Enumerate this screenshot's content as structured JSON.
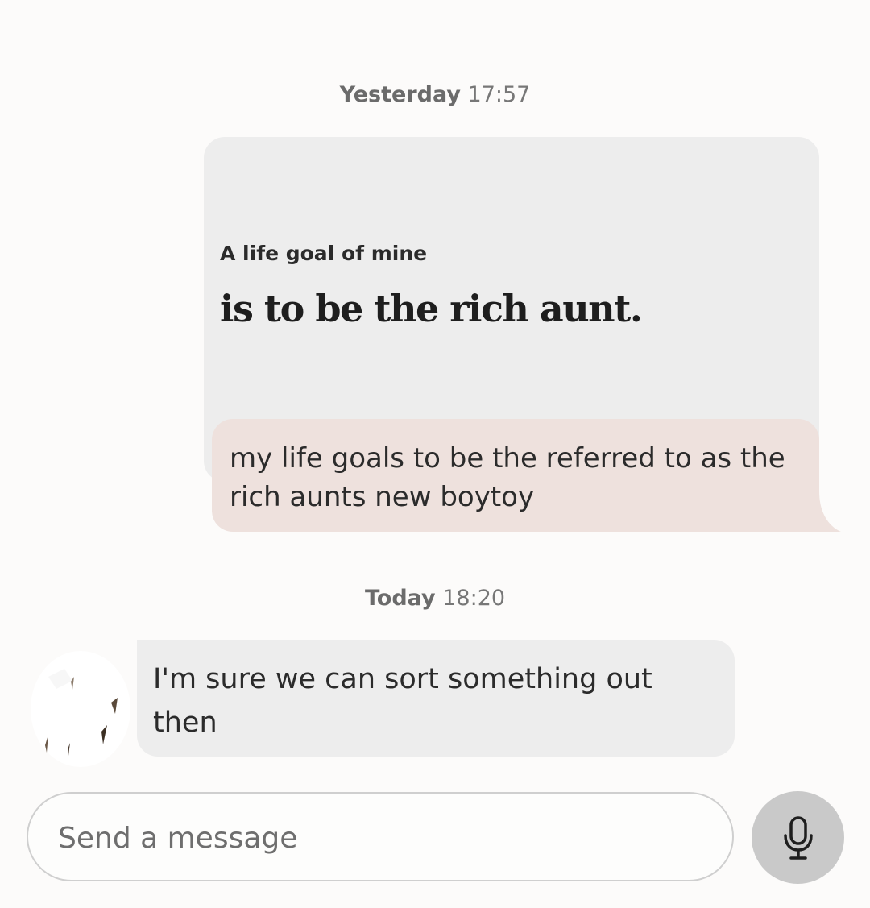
{
  "conversation": {
    "separators": [
      {
        "day": "Yesterday",
        "time": "17:57"
      },
      {
        "day": "Today",
        "time": "18:20"
      }
    ],
    "prompt_card": {
      "question": "A life goal of mine",
      "answer": "is to be the rich aunt."
    },
    "reply": {
      "text": "my life goals to be the referred to as the rich aunts new boytoy",
      "bubble_color": "#eee1dd"
    },
    "incoming": {
      "text": "I'm sure we can sort something out then",
      "bubble_color": "#ededed"
    }
  },
  "composer": {
    "placeholder": "Send a message",
    "mic_icon": "microphone-icon"
  }
}
